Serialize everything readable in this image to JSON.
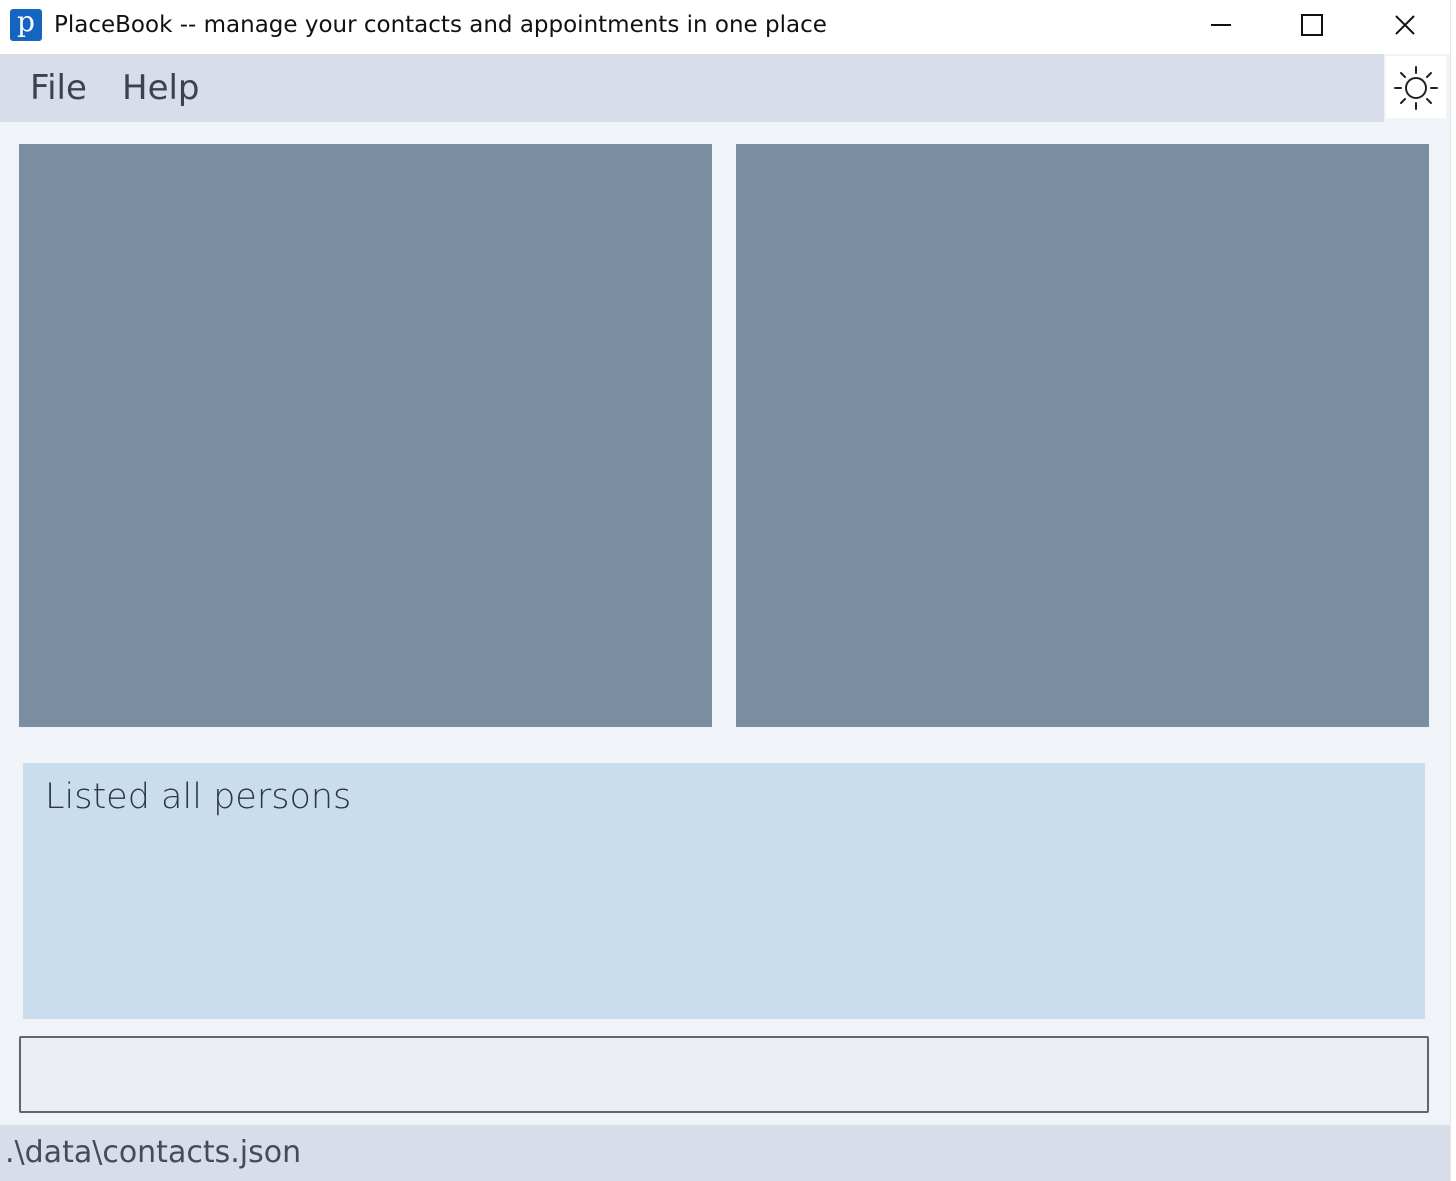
{
  "window": {
    "title": "PlaceBook -- manage your contacts and appointments in one place",
    "app_icon_letter": "p",
    "icon_color": "#1565c0"
  },
  "menu": {
    "items": [
      {
        "label": "File"
      },
      {
        "label": "Help"
      }
    ]
  },
  "theme_toggle": {
    "icon": "sun-icon"
  },
  "panels": {
    "left_color": "#7a8ea2",
    "right_color": "#7a8ea2"
  },
  "result_display": {
    "text": "Listed all persons",
    "background": "#c9ddee"
  },
  "command_box": {
    "value": "",
    "placeholder": ""
  },
  "status_bar": {
    "save_location": ".\\data\\contacts.json"
  }
}
